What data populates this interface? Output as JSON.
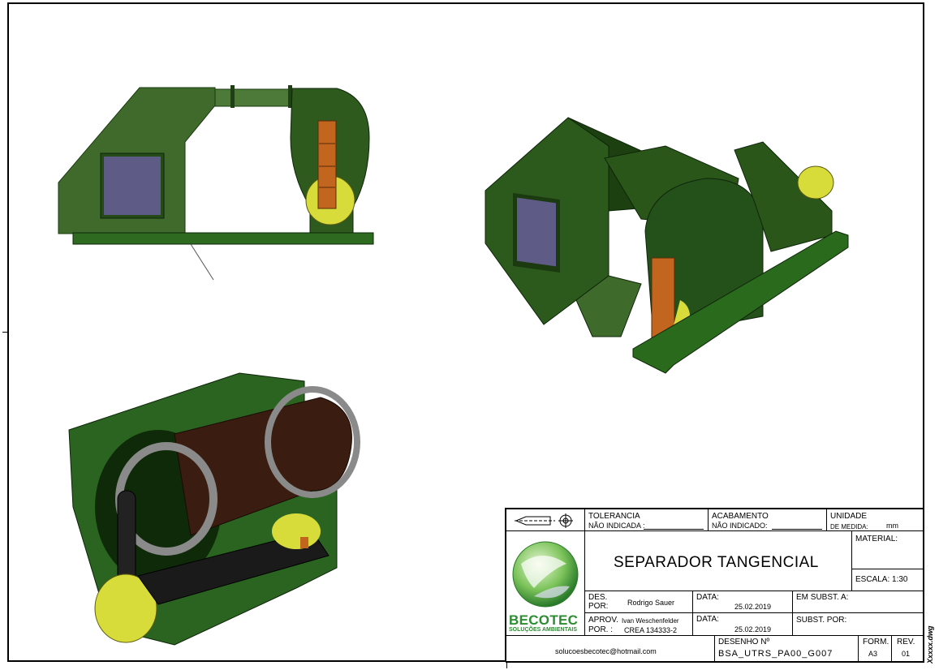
{
  "drawing": {
    "title": "SEPARADOR TANGENCIAL",
    "tolerance_label": "TOLERANCIA",
    "tolerance_value": "NÃO INDICADA :",
    "finish_label": "ACABAMENTO",
    "finish_value": "NÃO INDICADO:",
    "unit_label": "UNIDADE",
    "unit_sub": "DE MEDIDA:",
    "unit_value": "mm",
    "material_label": "MATERIAL:",
    "scale_label": "ESCALA: 1:30",
    "des_label": "DES.",
    "por_label": "POR:",
    "designer": "Rodrigo Sauer",
    "data_label": "DATA:",
    "date_design": "25.02.2019",
    "replaces_label": "EM SUBST. A:",
    "approved_label": "APROV.",
    "approver": "Ivan Weschenfelder",
    "por2_label": "POR. :",
    "crea": "CREA 134333-2",
    "date_approved": "25.02.2019",
    "replaced_by_label": "SUBST. POR:",
    "email": "solucoesbecotec@hotmail.com",
    "drawing_no_label": "DESENHO Nº",
    "drawing_no": "BSA_UTRS_PA00_G007",
    "format_label": "FORM.",
    "format_value": "A3",
    "rev_label": "REV.",
    "rev_value": "01",
    "file_name": "Xxxxx.dwg"
  },
  "logo": {
    "name": "BECOTEC",
    "tagline": "SOLUÇÕES AMBIENTAIS"
  },
  "colors": {
    "machine_green": "#1f4d14",
    "machine_light": "#3e6b2c",
    "orange": "#c2651f",
    "yellow": "#d8dc3a",
    "drum": "#3a1d10",
    "window": "#5e5b86",
    "logo_green": "#2a8d2f"
  }
}
